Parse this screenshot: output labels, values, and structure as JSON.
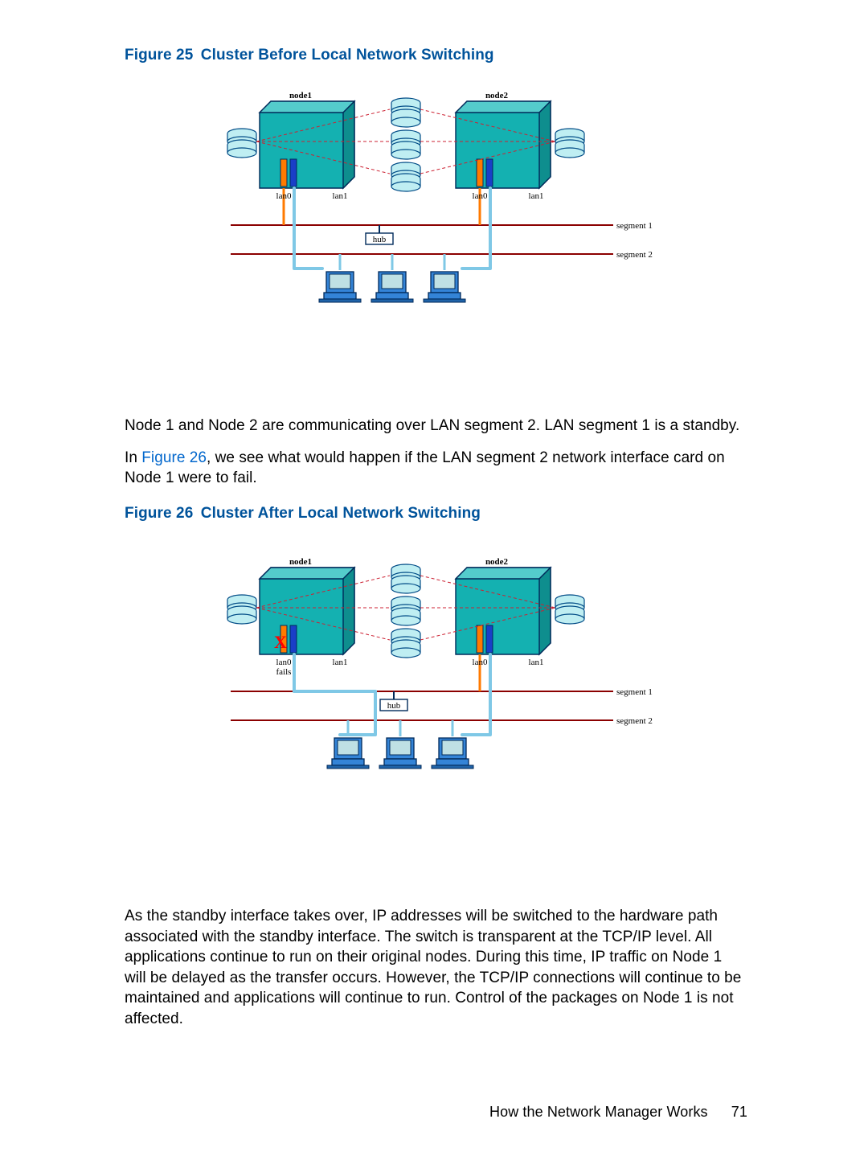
{
  "figure25": {
    "caption_prefix": "Figure 25",
    "caption_title": "Cluster Before Local Network Switching",
    "labels": {
      "node1": "node1",
      "node2": "node2",
      "lan0_a": "lan0",
      "lan1_a": "lan1",
      "lan0_b": "lan0",
      "lan1_b": "lan1",
      "hub": "hub",
      "segment1": "segment 1",
      "segment2": "segment 2"
    }
  },
  "para1": {
    "line1": "Node 1 and Node 2 are communicating over LAN segment 2. LAN segment 1 is a standby.",
    "line2a": "In ",
    "xref": "Figure 26",
    "line2b": ", we see what would happen if the LAN segment 2 network interface card on Node 1 were to fail."
  },
  "figure26": {
    "caption_prefix": "Figure 26",
    "caption_title": "Cluster After Local Network Switching",
    "labels": {
      "node1": "node1",
      "node2": "node2",
      "lan0_a": "lan0",
      "fails": "fails",
      "lan1_a": "lan1",
      "lan0_b": "lan0",
      "lan1_b": "lan1",
      "hub": "hub",
      "segment1": "segment 1",
      "segment2": "segment 2"
    }
  },
  "para2": "As the standby interface takes over, IP addresses will be switched to the hardware path associated with the standby interface. The switch is transparent at the TCP/IP level. All applications continue to run on their original nodes. During this time, IP traffic on Node 1 will be delayed as the transfer occurs. However, the TCP/IP connections will continue to be maintained and applications will continue to run. Control of the packages on Node 1 is not affected.",
  "footer": {
    "section": "How the Network Manager Works",
    "page": "71"
  }
}
